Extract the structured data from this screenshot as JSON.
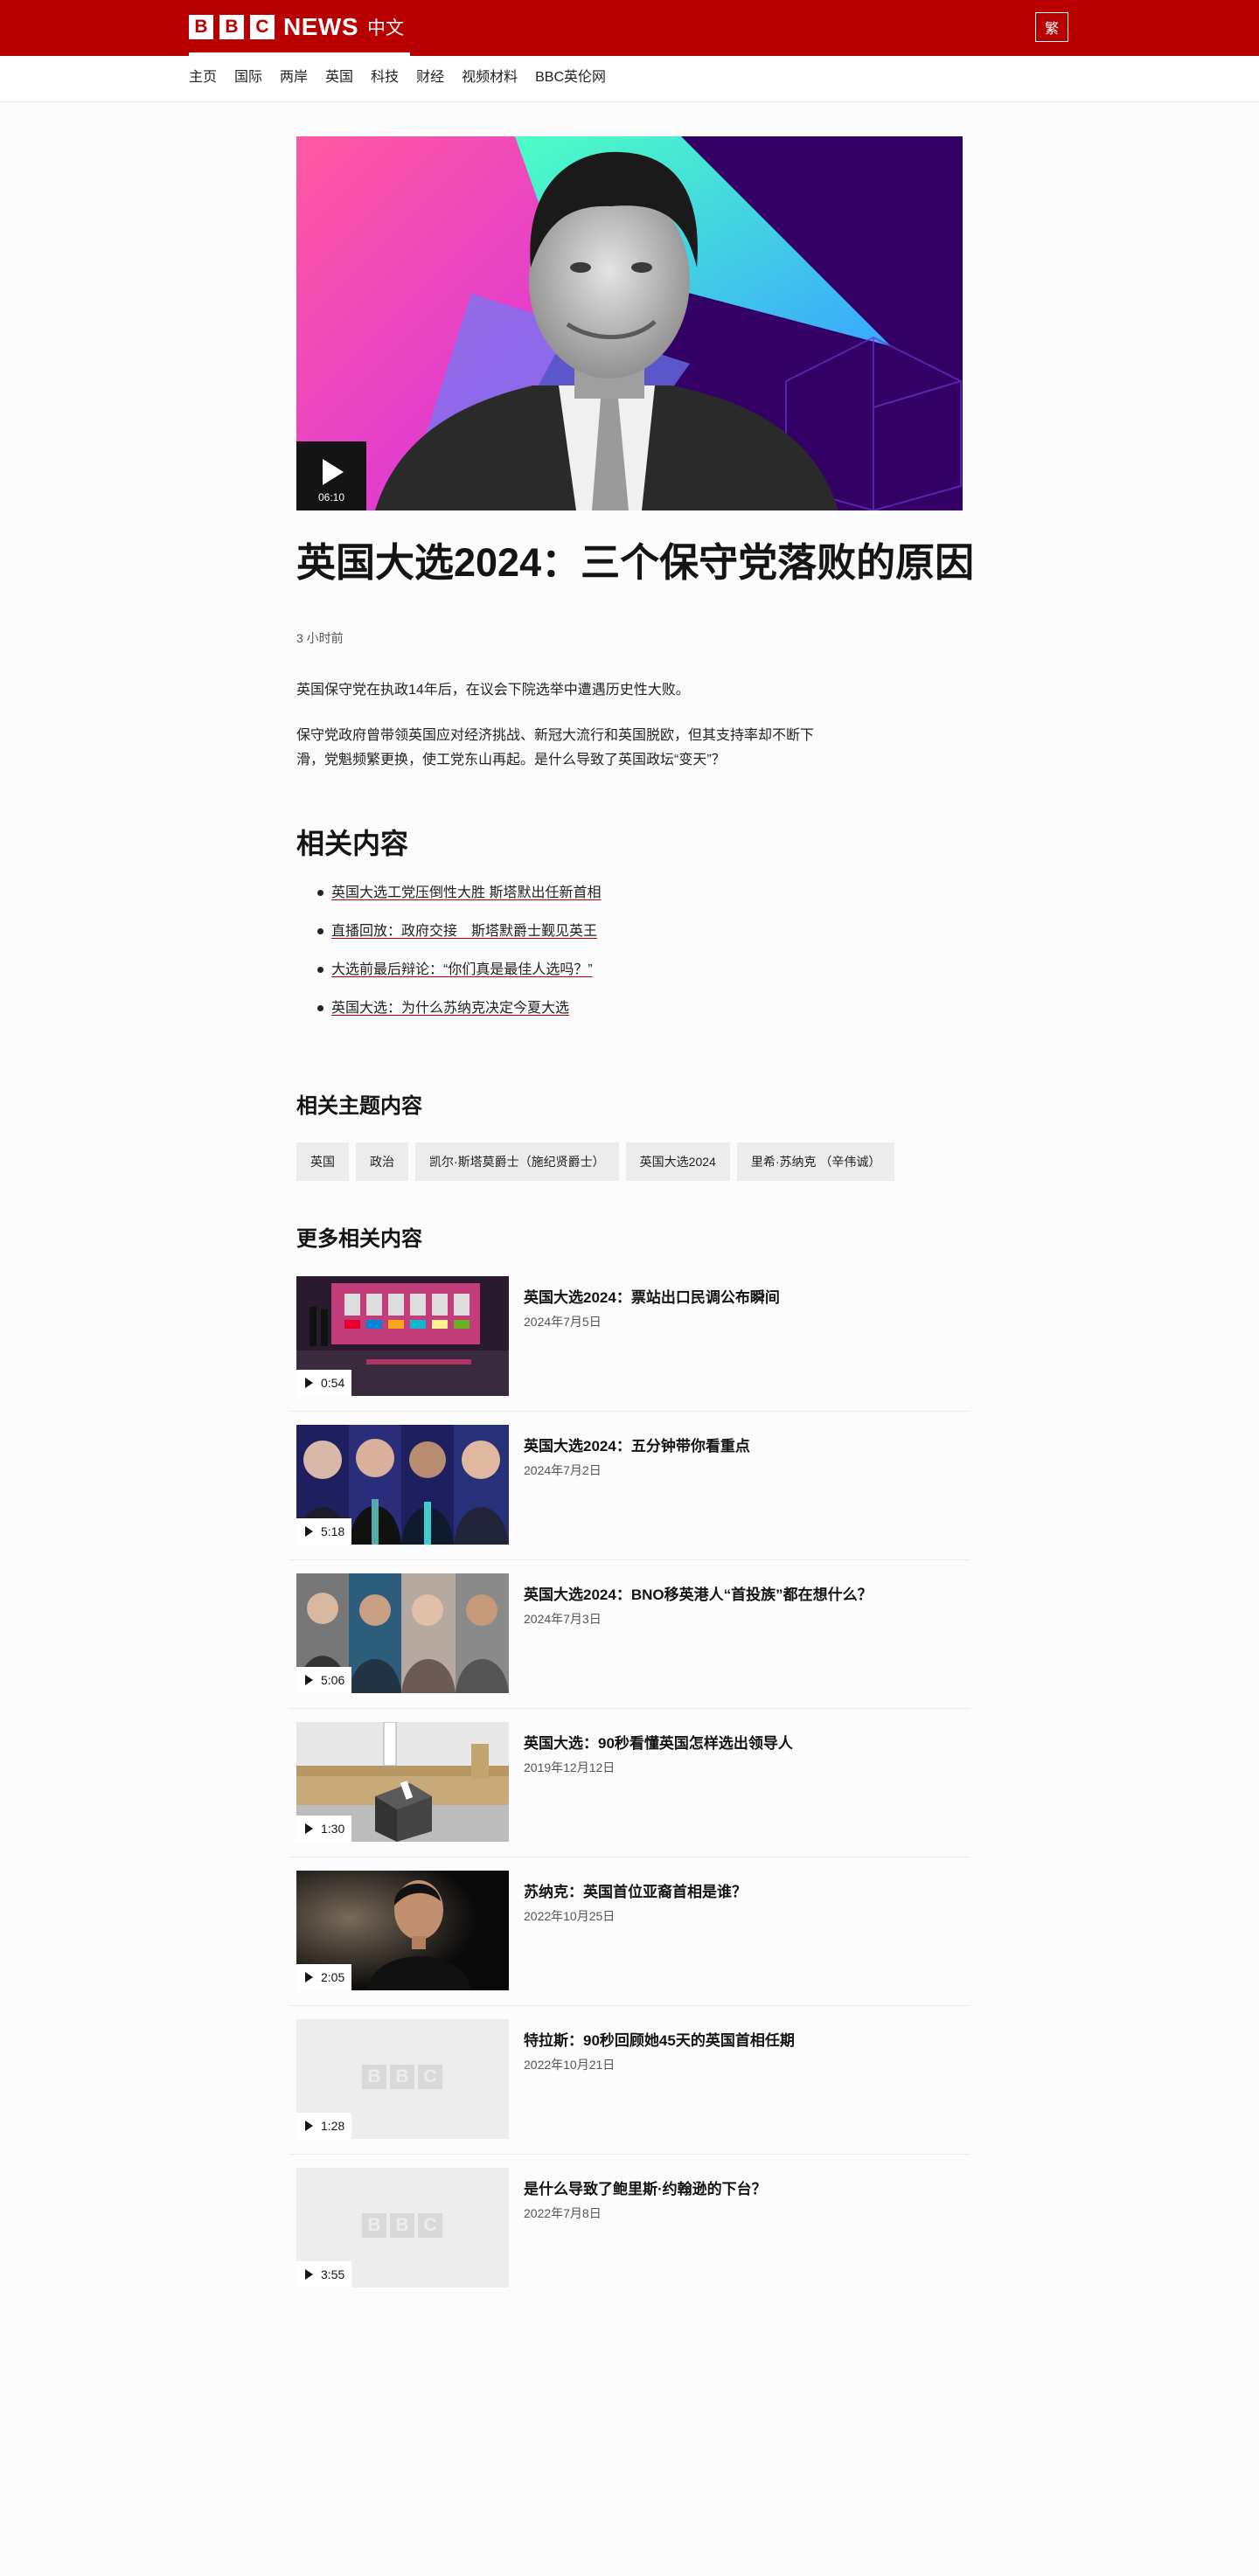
{
  "header": {
    "logo_letters": [
      "B",
      "B",
      "C"
    ],
    "logo_news": "NEWS",
    "logo_lang": "中文",
    "lang_toggle": "繁",
    "brand_color": "#b80000"
  },
  "nav": {
    "items": [
      "主页",
      "国际",
      "两岸",
      "英国",
      "科技",
      "财经",
      "视频材料",
      "BBC英伦网"
    ]
  },
  "hero": {
    "duration": "06:10",
    "play_icon": "play-icon"
  },
  "article": {
    "headline": "英国大选2024：三个保守党落败的原因",
    "timestamp": "3 小时前",
    "paragraphs": [
      "英国保守党在执政14年后，在议会下院选举中遭遇历史性大败。",
      "保守党政府曾带领英国应对经济挑战、新冠大流行和英国脱欧，但其支持率却不断下滑，党魁频繁更换，使工党东山再起。是什么导致了英国政坛“变天”？"
    ]
  },
  "related": {
    "heading": "相关内容",
    "links": [
      "英国大选工党压倒性大胜 斯塔默出任新首相",
      "直播回放：政府交接　斯塔默爵士觐见英王",
      "大选前最后辩论：“你们真是最佳人选吗？”",
      "英国大选：为什么苏纳克决定今夏大选"
    ]
  },
  "topics": {
    "heading": "相关主题内容",
    "tags": [
      "英国",
      "政治",
      "凯尔·斯塔莫爵士（施纪贤爵士）",
      "英国大选2024",
      "里希·苏纳克 （辛伟诚）"
    ]
  },
  "more": {
    "heading": "更多相关内容",
    "items": [
      {
        "title": "英国大选2024：票站出口民调公布瞬间",
        "date": "2024年7月5日",
        "duration": "0:54"
      },
      {
        "title": "英国大选2024：五分钟带你看重点",
        "date": "2024年7月2日",
        "duration": "5:18"
      },
      {
        "title": "英国大选2024：BNO移英港人“首投族”都在想什么？",
        "date": "2024年7月3日",
        "duration": "5:06"
      },
      {
        "title": "英国大选：90秒看懂英国怎样选出领导人",
        "date": "2019年12月12日",
        "duration": "1:30"
      },
      {
        "title": "苏纳克：英国首位亚裔首相是谁？",
        "date": "2022年10月25日",
        "duration": "2:05"
      },
      {
        "title": "特拉斯：90秒回顾她45天的英国首相任期",
        "date": "2022年10月21日",
        "duration": "1:28"
      },
      {
        "title": "是什么导致了鲍里斯·约翰逊的下台？",
        "date": "2022年7月8日",
        "duration": "3:55"
      }
    ]
  }
}
